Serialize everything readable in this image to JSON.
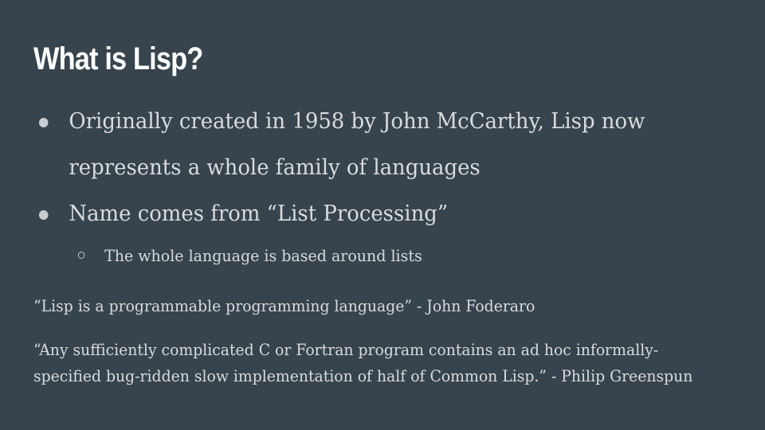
{
  "slide": {
    "title": "What is Lisp?",
    "bullets": [
      "Originally created in 1958 by John McCarthy, Lisp now represents a whole family of languages",
      "Name comes from “List Processing”"
    ],
    "sub_bullets": [
      "The whole language is based around lists"
    ],
    "quotes": [
      "“Lisp is a programmable programming language” - John Foderaro",
      "“Any sufficiently complicated C or Fortran program contains an ad hoc informally-specified bug-ridden slow implementation of half of Common Lisp.” - Philip Greenspun"
    ]
  },
  "colors": {
    "background": "#37444d",
    "title": "#ffffff",
    "body_text": "#d9dcde"
  }
}
